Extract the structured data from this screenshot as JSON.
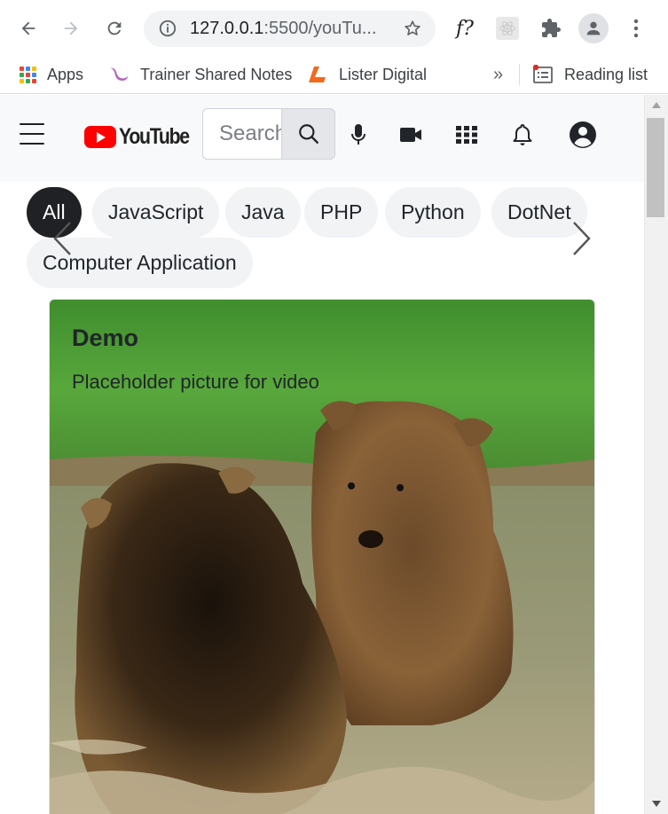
{
  "browser": {
    "url_host": "127.0.0.1",
    "url_rest": ":5500/youTu...",
    "extension_label": "f?",
    "bookmarks": [
      {
        "label": "Apps"
      },
      {
        "label": "Trainer Shared Notes"
      },
      {
        "label": "Lister Digital"
      }
    ],
    "overflow_label": "»",
    "reading_list_label": "Reading list"
  },
  "youtube": {
    "logo_text": "YouTube",
    "search_placeholder": "Search",
    "chips": [
      "All",
      "JavaScript",
      "Java",
      "PHP",
      "Python",
      "DotNet",
      "Computer Application"
    ],
    "active_chip": "All",
    "card": {
      "title": "Demo",
      "text": "Placeholder picture for video"
    }
  },
  "colors": {
    "brand_red": "#ff0000",
    "chip_active_bg": "#202124",
    "chip_bg": "#f1f3f5"
  }
}
